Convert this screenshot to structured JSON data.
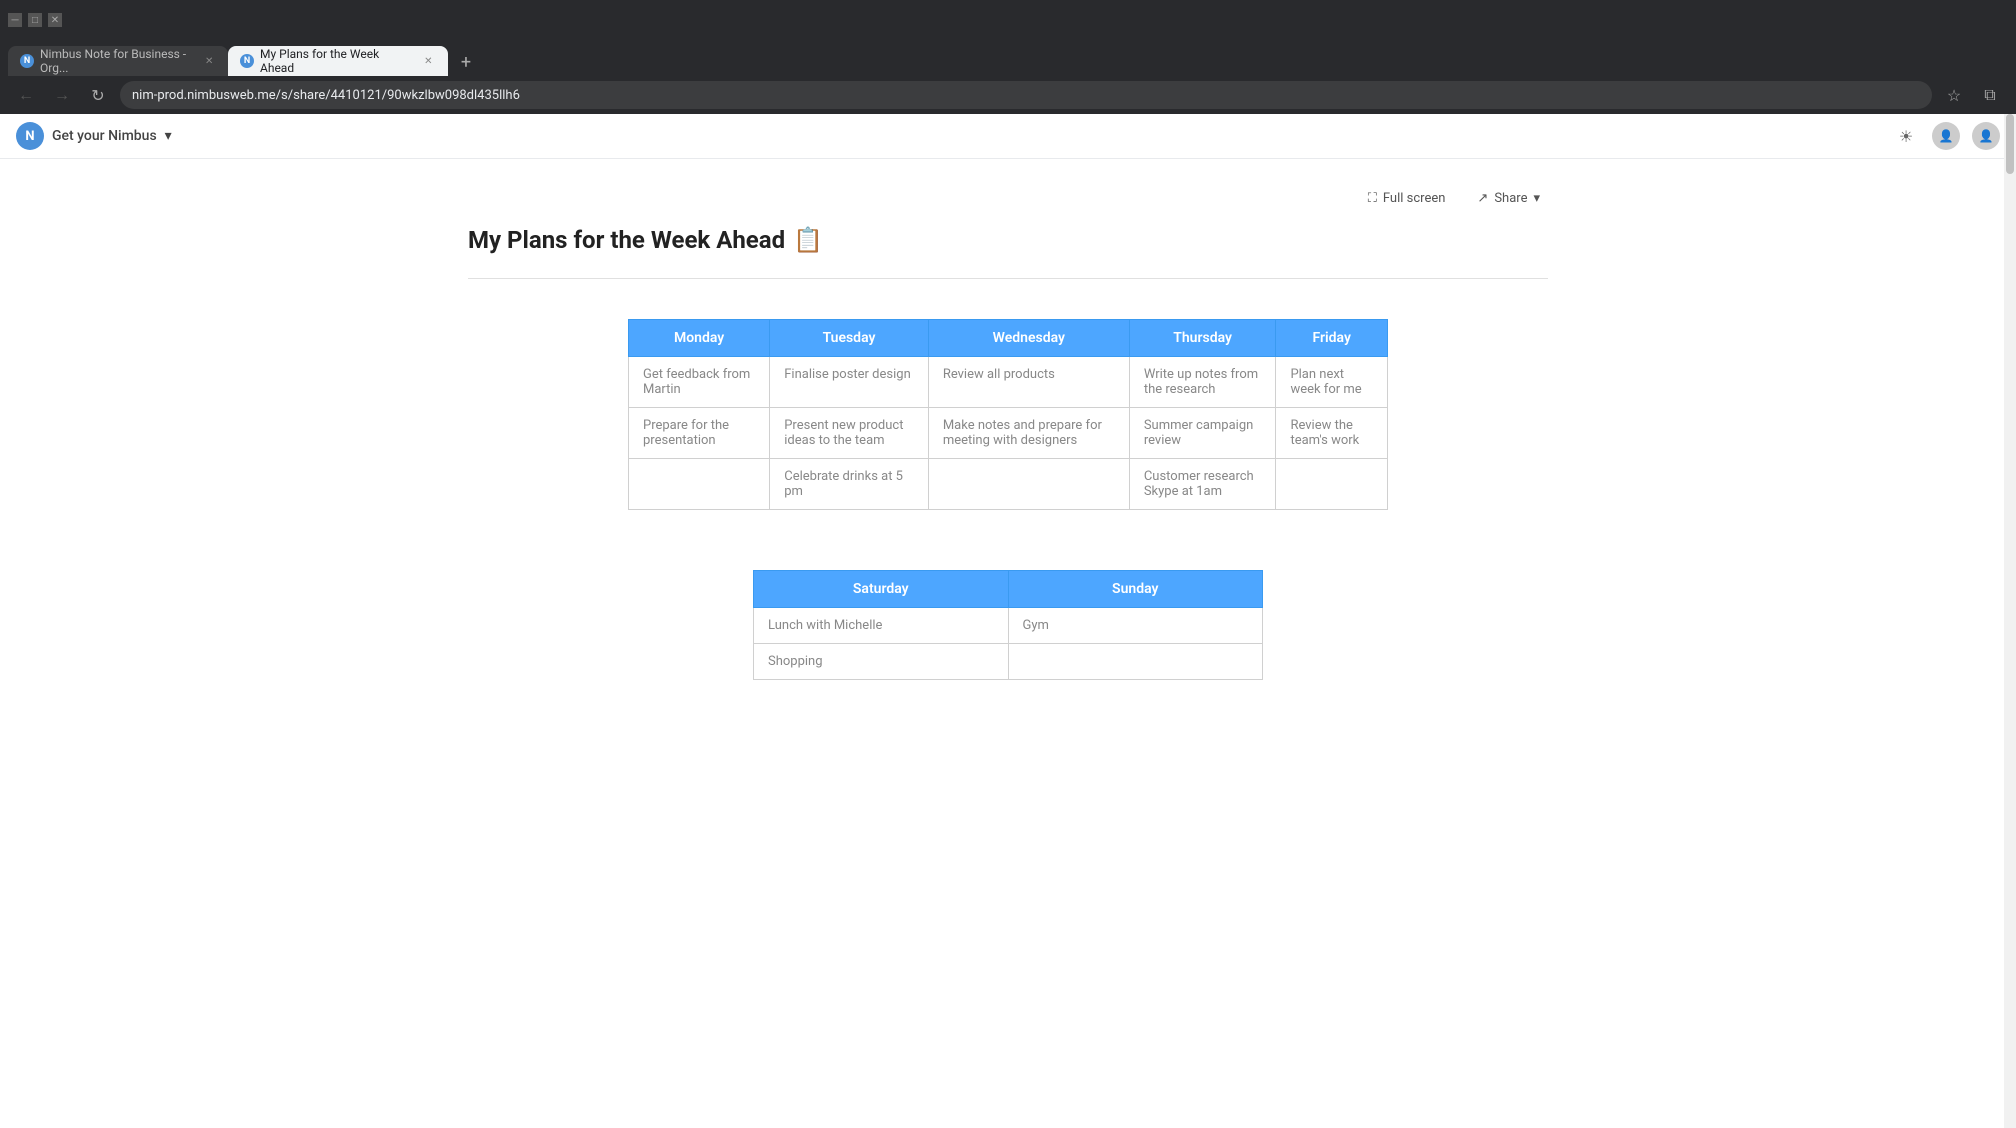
{
  "browser": {
    "tabs": [
      {
        "id": "tab1",
        "label": "Nimbus Note for Business - Org...",
        "icon": "N",
        "active": false
      },
      {
        "id": "tab2",
        "label": "My Plans for the Week Ahead",
        "icon": "N",
        "active": true
      }
    ],
    "url": "nim-prod.nimbusweb.me/s/share/4410121/90wkzlbw098dl435llh6",
    "new_tab_icon": "+",
    "back_icon": "←",
    "forward_icon": "→",
    "refresh_icon": "↻",
    "bookmark_icon": "☆",
    "extensions_icon": "⧉"
  },
  "header": {
    "brand": "Get your Nimbus",
    "brand_dropdown": "▾",
    "fullscreen_label": "Full screen",
    "share_label": "Share",
    "share_dropdown": "▾"
  },
  "page": {
    "title": "My Plans for the Week Ahead",
    "title_icon": "📋"
  },
  "weekday_table": {
    "headers": [
      "Monday",
      "Tuesday",
      "Wednesday",
      "Thursday",
      "Friday"
    ],
    "rows": [
      [
        "Get feedback from Martin",
        "Finalise poster design",
        "Review all products",
        "Write up notes from the research",
        "Plan next week for me"
      ],
      [
        "Prepare for the presentation",
        "Present new product ideas to the team",
        "Make notes and prepare for meeting with designers",
        "Summer campaign review",
        "Review the team's work"
      ],
      [
        "",
        "Celebrate drinks at 5 pm",
        "",
        "Customer research Skype at 1am",
        ""
      ]
    ]
  },
  "weekend_table": {
    "headers": [
      "Saturday",
      "Sunday"
    ],
    "rows": [
      [
        "Lunch with Michelle",
        "Gym"
      ],
      [
        "Shopping",
        ""
      ]
    ]
  }
}
